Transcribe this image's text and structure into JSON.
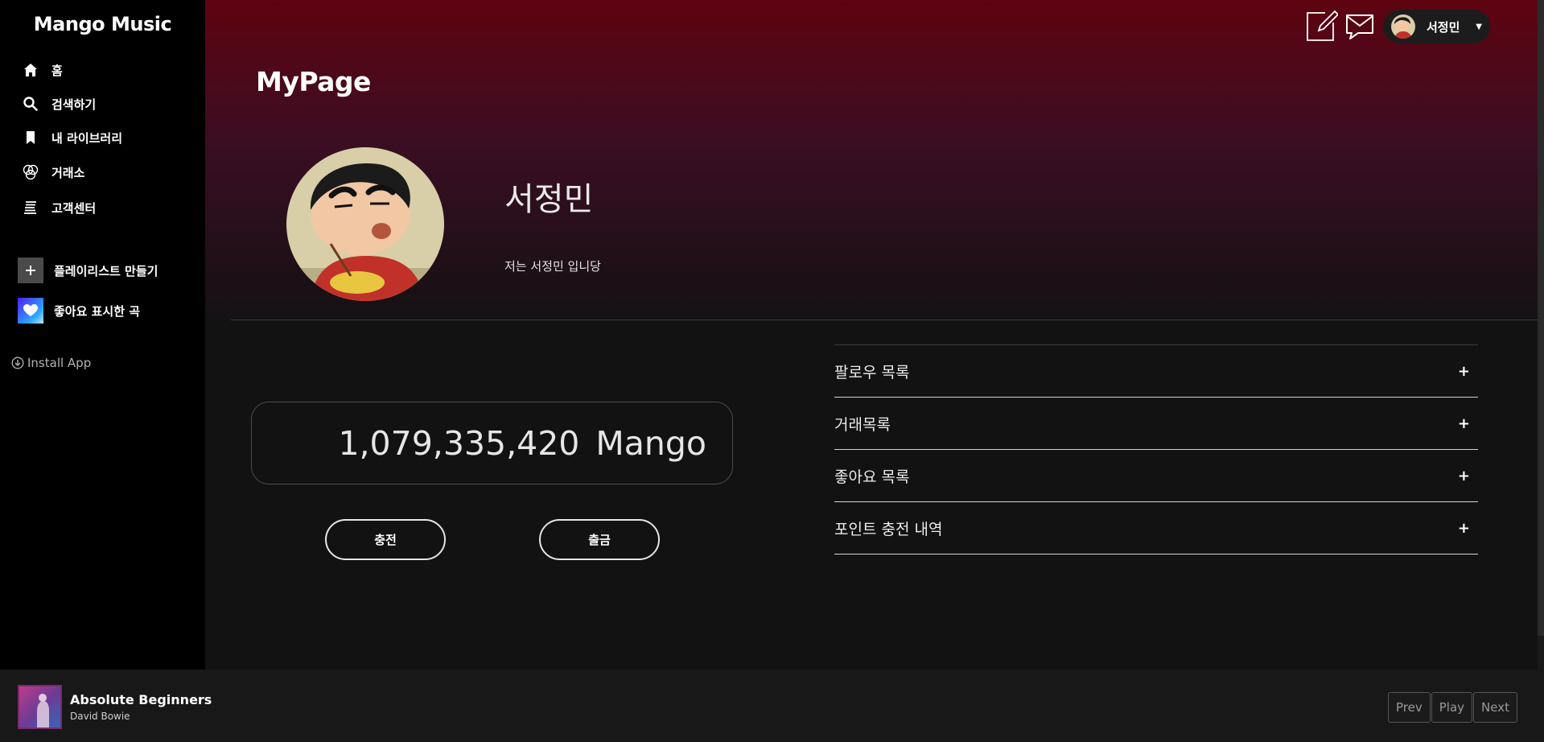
{
  "app": {
    "brand": "Mango Music"
  },
  "sidebar": {
    "nav": [
      {
        "label": "홈",
        "icon": "home-icon"
      },
      {
        "label": "검색하기",
        "icon": "search-icon"
      },
      {
        "label": "내 라이브러리",
        "icon": "bookmark-icon"
      },
      {
        "label": "거래소",
        "icon": "exchange-icon"
      },
      {
        "label": "고객센터",
        "icon": "support-icon"
      }
    ],
    "playlists": [
      {
        "label": "플레이리스트 만들기",
        "icon": "plus-icon"
      },
      {
        "label": "좋아요 표시한 곡",
        "icon": "heart-icon"
      }
    ],
    "install_label": "Install App"
  },
  "header": {
    "user_name": "서정민"
  },
  "page": {
    "title": "MyPage",
    "profile": {
      "name": "서정민",
      "bio": "저는 서정민 입니당"
    },
    "wallet": {
      "balance": "1,079,335,420",
      "unit": "Mango",
      "charge_label": "충전",
      "withdraw_label": "출금"
    },
    "accordion": [
      {
        "label": "팔로우 목록",
        "toggle": "+"
      },
      {
        "label": "거래목록",
        "toggle": "+"
      },
      {
        "label": "좋아요 목록",
        "toggle": "+"
      },
      {
        "label": "포인트 충전 내역",
        "toggle": "+"
      }
    ]
  },
  "player": {
    "title": "Absolute Beginners",
    "artist": "David Bowie",
    "prev_label": "Prev",
    "play_label": "Play",
    "next_label": "Next"
  },
  "colors": {
    "hero_top": "#5e0310",
    "hero_mid": "#3b0e23",
    "background": "#121212",
    "sidebar": "#000000",
    "player": "#181818"
  }
}
